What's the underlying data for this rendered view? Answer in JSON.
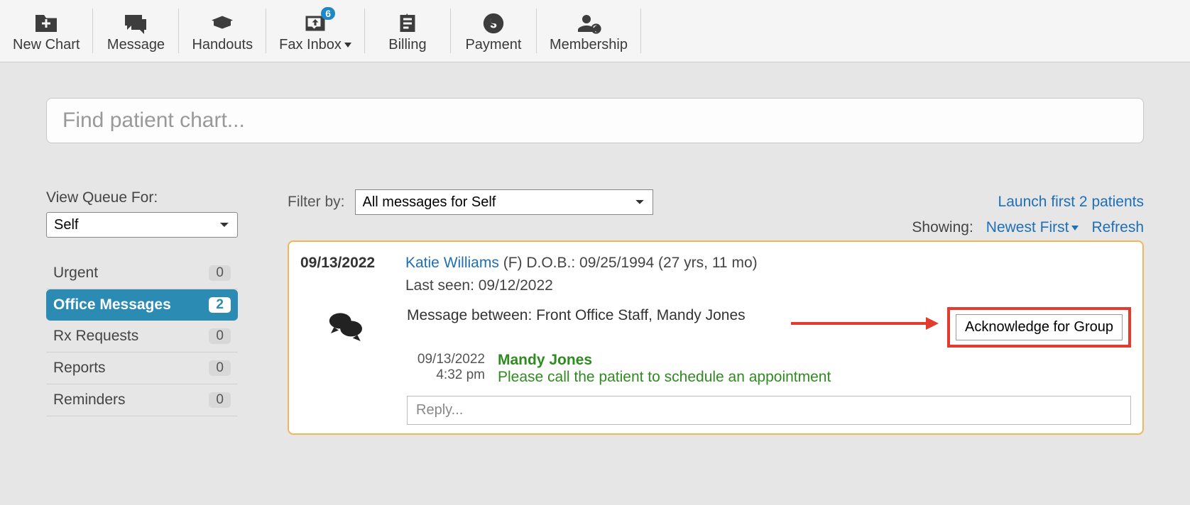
{
  "toolbar": {
    "new_chart": "New Chart",
    "message": "Message",
    "handouts": "Handouts",
    "fax_inbox": "Fax Inbox",
    "fax_badge": "6",
    "billing": "Billing",
    "payment": "Payment",
    "membership": "Membership"
  },
  "search": {
    "placeholder": "Find patient chart..."
  },
  "sidebar": {
    "queue_label": "View Queue For:",
    "queue_value": "Self",
    "items": [
      {
        "label": "Urgent",
        "count": "0",
        "active": false
      },
      {
        "label": "Office Messages",
        "count": "2",
        "active": true
      },
      {
        "label": "Rx Requests",
        "count": "0",
        "active": false
      },
      {
        "label": "Reports",
        "count": "0",
        "active": false
      },
      {
        "label": "Reminders",
        "count": "0",
        "active": false
      }
    ]
  },
  "filter": {
    "label": "Filter by:",
    "value": "All messages for Self",
    "launch_link": "Launch first 2 patients",
    "showing_label": "Showing:",
    "sort": "Newest First",
    "refresh": "Refresh"
  },
  "message": {
    "date": "09/13/2022",
    "patient_name": "Katie Williams",
    "patient_meta": "(F)  D.O.B.: 09/25/1994 (27 yrs, 11 mo)",
    "last_seen_label": "Last seen: 09/12/2022",
    "between": "Message between: Front Office Staff, Mandy Jones",
    "ack_button": "Acknowledge for Group",
    "ts_date": "09/13/2022",
    "ts_time": "4:32 pm",
    "author": "Mandy Jones",
    "text": "Please call the patient to schedule an appointment",
    "reply_placeholder": "Reply..."
  }
}
